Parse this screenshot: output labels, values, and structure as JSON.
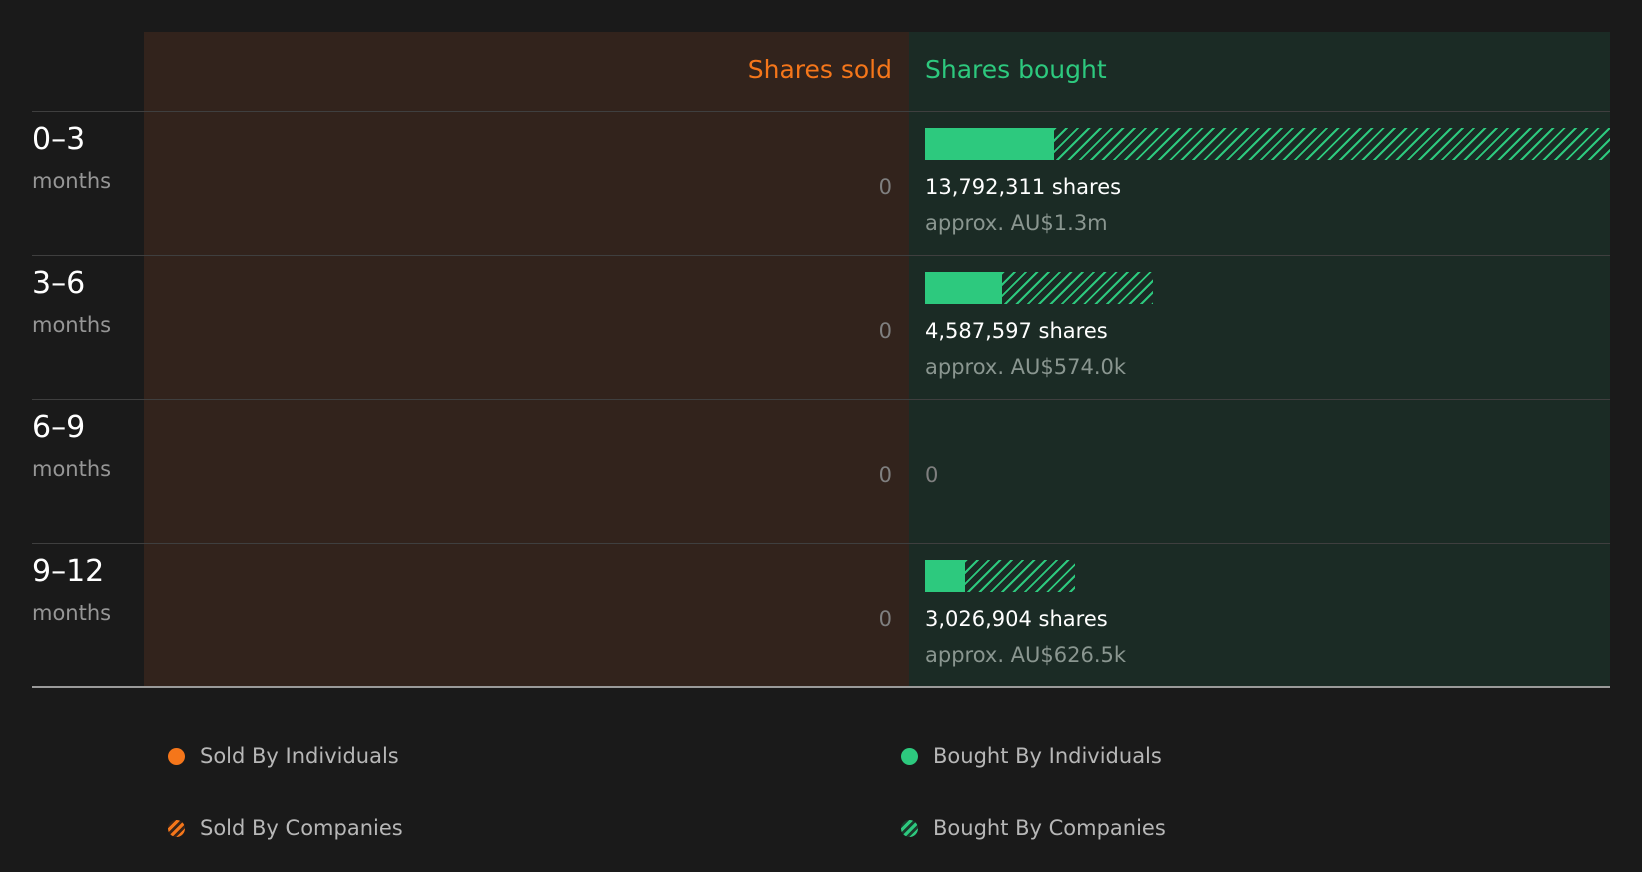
{
  "chart_data": {
    "type": "bar",
    "headers": {
      "sold": "Shares sold",
      "bought": "Shares bought"
    },
    "rows": [
      {
        "range": "0–3",
        "unit": "months",
        "sold_label": "0",
        "bought_individuals": 2600000,
        "bought_companies": 11192311,
        "shares_label": "13,792,311 shares",
        "approx_label": "approx. AU$1.3m",
        "bought_zero_label": ""
      },
      {
        "range": "3–6",
        "unit": "months",
        "sold_label": "0",
        "bought_individuals": 1550000,
        "bought_companies": 3037597,
        "shares_label": "4,587,597 shares",
        "approx_label": "approx. AU$574.0k",
        "bought_zero_label": ""
      },
      {
        "range": "6–9",
        "unit": "months",
        "sold_label": "0",
        "bought_individuals": 0,
        "bought_companies": 0,
        "shares_label": "",
        "approx_label": "",
        "bought_zero_label": "0"
      },
      {
        "range": "9–12",
        "unit": "months",
        "sold_label": "0",
        "bought_individuals": 800000,
        "bought_companies": 2226904,
        "shares_label": "3,026,904 shares",
        "approx_label": "approx. AU$626.5k",
        "bought_zero_label": ""
      }
    ],
    "max_bought": 13792311,
    "legend": [
      {
        "label": "Sold By Individuals",
        "style": "solid",
        "color": "#f5761a"
      },
      {
        "label": "Bought By Individuals",
        "style": "solid",
        "color": "#2dc97e"
      },
      {
        "label": "Sold By Companies",
        "style": "hatched",
        "color": "#f5761a"
      },
      {
        "label": "Bought By Companies",
        "style": "hatched",
        "color": "#2dc97e"
      }
    ]
  },
  "colors": {
    "sold": "#f5761a",
    "bought": "#2dc97e",
    "background": "#1a1a1a"
  }
}
